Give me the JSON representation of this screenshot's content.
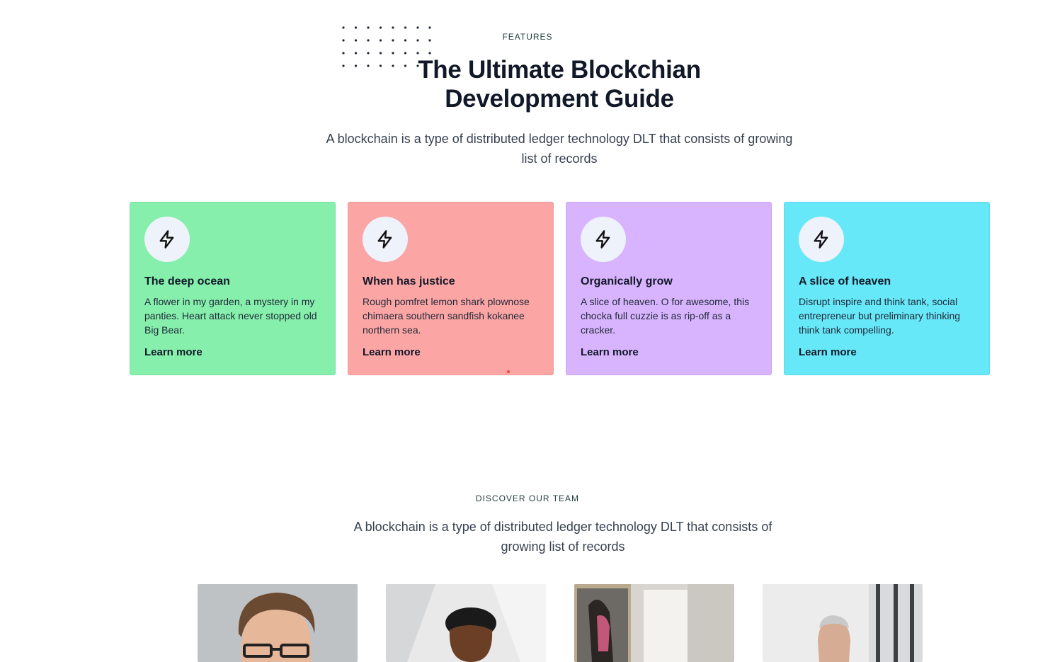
{
  "features": {
    "eyebrow": "FEATURES",
    "title_line1": "The Ultimate Blockchian",
    "title_line2": "Development Guide",
    "description": "A blockchain is a type of distributed ledger technology DLT that consists of growing list of records",
    "cards": [
      {
        "title": "The deep ocean",
        "text": "A flower in my garden, a mystery in my panties. Heart attack never stopped old Big Bear.",
        "link": "Learn more",
        "color": "#86efac",
        "icon": "lightning-icon"
      },
      {
        "title": "When has justice",
        "text": "Rough pomfret lemon shark plownose chimaera southern sandfish kokanee northern sea.",
        "link": "Learn more",
        "color": "#fca5a5",
        "icon": "lightning-icon"
      },
      {
        "title": "Organically grow",
        "text": "A slice of heaven. O for awesome, this chocka full cuzzie is as rip-off as a cracker.",
        "link": "Learn more",
        "color": "#d8b4fe",
        "icon": "lightning-icon"
      },
      {
        "title": "A slice of heaven",
        "text": "Disrupt inspire and think tank, social entrepreneur but preliminary thinking think tank compelling.",
        "link": "Learn more",
        "color": "#67e8f9",
        "icon": "lightning-icon"
      }
    ]
  },
  "team": {
    "eyebrow": "DISCOVER OUR TEAM",
    "description": "A blockchain is a type of distributed ledger technology DLT that consists of growing list of records"
  }
}
